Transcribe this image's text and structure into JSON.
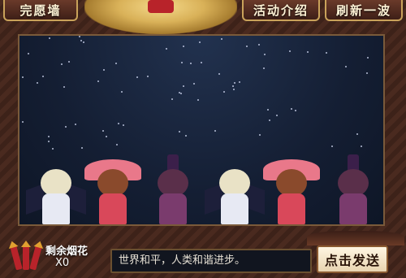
{
  "header": {
    "wish_wall_label": "完愿墙",
    "event_intro_label": "活动介绍",
    "refresh_label": "刷新一波"
  },
  "fireworks": {
    "label": "剩余烟花",
    "count": "X0"
  },
  "message": {
    "text": "世界和平，人类和谐进步。"
  },
  "send_button": {
    "label": "点击发送"
  },
  "colors": {
    "frame": "#3d2219",
    "sky": "#141e33",
    "gold_trim": "#c9a25a",
    "text_light": "#fff3d6"
  },
  "icons": {
    "firework": "firework-rockets-icon",
    "cloud": "auspicious-cloud-ornament"
  }
}
